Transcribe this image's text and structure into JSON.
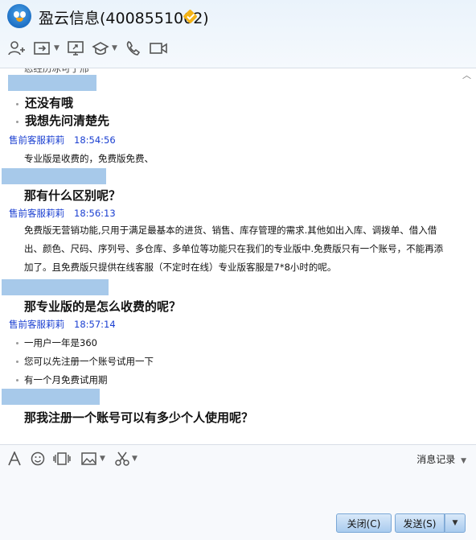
{
  "window": {
    "title": "盈云信息(4008551002)"
  },
  "chat": {
    "cut_top_text": "忍经历冰可了邢",
    "messages": [
      {
        "type": "user_bullets",
        "lines": [
          "还没有哦",
          "我想先问清楚先"
        ]
      },
      {
        "type": "agent",
        "sender": "售前客服莉莉",
        "time": "18:54:56",
        "text": "专业版是收费的，免费版免费、"
      },
      {
        "type": "user",
        "text": "那有什么区别呢？"
      },
      {
        "type": "agent_para",
        "sender": "售前客服莉莉",
        "time": "18:56:13",
        "lines": [
          "免费版无营销功能,只用于满足最基本的进货、销售、库存管理的需求.其他如出入库、调拨单、借入借",
          "出、颜色、尺码、序列号、多仓库、多单位等功能只在我们的专业版中.免费版只有一个账号，不能再添",
          "加了。且免费版只提供在线客服（不定时在线）专业版客服是7*8小时的呢。"
        ]
      },
      {
        "type": "user",
        "text": "那专业版的是怎么收费的呢？"
      },
      {
        "type": "agent_bullets",
        "sender": "售前客服莉莉",
        "time": "18:57:14",
        "lines": [
          "一用户一年是360",
          "您可以先注册一个账号试用一下",
          "有一个月免费试用期"
        ]
      },
      {
        "type": "user",
        "text": "那我注册一个账号可以有多少个人使用呢？"
      }
    ]
  },
  "composer": {
    "history_label": "消息记录",
    "close_label": "关闭(C)",
    "send_label": "发送(S)"
  },
  "colors": {
    "sender": "#1a3fd1",
    "redaction": "#a7c9ea",
    "button": "#a9cbee"
  }
}
